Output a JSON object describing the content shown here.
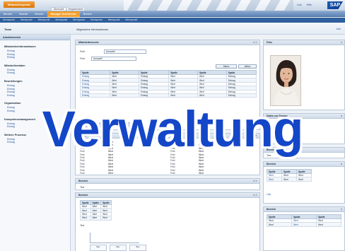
{
  "header": {
    "brand": "Mitarbeiterportal",
    "tab_active": "Übersicht",
    "tab_other": "Registerkarte",
    "links": [
      "Link",
      "Hilfe"
    ],
    "logo": "SAP"
  },
  "nav1": [
    "Bereich",
    "Bereich",
    "Bereich",
    "Manager Self-Service",
    "Bereich"
  ],
  "nav1_active_index": 3,
  "nav2": [
    "Menüpunkt",
    "Menüpunkt",
    "Menüpunkt",
    "Menüpunkt",
    "Menüpunkt",
    "Menüpunkt",
    "Menüpunkt",
    "Menüpunkt"
  ],
  "titlebar": {
    "left": "Team",
    "middle": "Allgemeine Informationen",
    "right": "Link"
  },
  "sidebar": {
    "header": "Arbeitsbereich",
    "groups": [
      {
        "title": "Mitarbeiterinformationen",
        "items": [
          "Eintrag",
          "Eintrag",
          "Eintrag"
        ]
      },
      {
        "title": "Mitarbeiterdaten",
        "items": [
          "Eintrag",
          "Eintrag"
        ]
      },
      {
        "title": "Beurteilungen",
        "items": [
          "Eintrag",
          "Eintrag",
          "Eintrag",
          "Eintrag"
        ]
      },
      {
        "title": "Organisation",
        "items": [
          "Eintrag",
          "Eintrag"
        ]
      },
      {
        "title": "Kompetenzmanagement",
        "items": [
          "Eintrag",
          "Eintrag"
        ]
      },
      {
        "title": "Weitere Prozesse",
        "items": [
          "Eintrag",
          "Eintrag"
        ]
      }
    ]
  },
  "panel_search": {
    "title": "Mitarbeitersuche",
    "field1_label": "Feld",
    "field1_value": "Auswahl",
    "field2_label": "Feld",
    "field2_value": "Auswahl",
    "btn1": "Aktion",
    "btn2": "Aktion",
    "columns": [
      "Spalte",
      "Spalte",
      "Spalte",
      "Spalte",
      "Spalte",
      "Spalte"
    ],
    "rows": [
      [
        "Eintrag",
        "Wert",
        "Eintrag",
        "Wert",
        "Wert",
        "Eintrag"
      ],
      [
        "Eintrag",
        "Wert",
        "Eintrag",
        "Wert",
        "Wert",
        "Eintrag"
      ],
      [
        "Eintrag",
        "Wert",
        "Eintrag",
        "Wert",
        "Wert",
        "Eintrag"
      ],
      [
        "Eintrag",
        "Wert",
        "Eintrag",
        "Wert",
        "Wert",
        "Eintrag"
      ],
      [
        "Eintrag",
        "Wert",
        "Eintrag",
        "Wert",
        "Wert",
        "Eintrag"
      ],
      [
        "Eintrag",
        "Wert",
        "Eintrag",
        "Wert",
        "Wert",
        "Eintrag"
      ]
    ],
    "selected_row": 1
  },
  "panel_details": {
    "title": "Details",
    "pairs_left": [
      [
        "Feld",
        "Wert"
      ],
      [
        "Feld",
        "Wert"
      ],
      [
        "Feld",
        "Wert"
      ],
      [
        "Feld",
        "Wert"
      ],
      [
        "Feld",
        "Wert"
      ],
      [
        "Feld",
        "Wert"
      ],
      [
        "Feld",
        "Wert"
      ],
      [
        "Feld",
        "Wert"
      ],
      [
        "Feld",
        "Wert"
      ],
      [
        "Feld",
        "Wert"
      ],
      [
        "Feld",
        "Wert"
      ]
    ],
    "pairs_right": [
      [
        "Feld",
        "Wert"
      ],
      [
        "Feld",
        "Wert"
      ],
      [
        "Feld",
        "Wert"
      ],
      [
        "Feld",
        "Wert"
      ],
      [
        "Feld",
        "Wert"
      ],
      [
        "Feld",
        "Wert"
      ],
      [
        "Feld",
        "Wert"
      ],
      [
        "Feld",
        "Wert"
      ],
      [
        "Feld",
        "Wert"
      ],
      [
        "Feld",
        "Wert"
      ],
      [
        "Feld",
        "Wert"
      ]
    ]
  },
  "panel_small": {
    "title": "Bereich",
    "text": "Text"
  },
  "panel_org": {
    "title": "Bereich",
    "columns": [
      "Spalte",
      "Spalte",
      "Spalte"
    ],
    "rows": [
      [
        "Wert",
        "Wert",
        "Wert"
      ],
      [
        "Wert",
        "Wert",
        "Wert"
      ],
      [
        "Wert",
        "Wert",
        "Wert"
      ],
      [
        "Wert",
        "Wert",
        "Wert"
      ]
    ],
    "footer": "Text",
    "chart_boxes": [
      "Box",
      "Box",
      "Box"
    ]
  },
  "right": {
    "photo_title": "Foto",
    "person_title": "Daten zur Person",
    "person_pairs": [
      [
        "Feld",
        "Wert"
      ],
      [
        "Feld",
        "Wert"
      ],
      [
        "Feld",
        "Wert"
      ],
      [
        "Feld",
        "Wert"
      ]
    ],
    "mini_title": "Bereich",
    "mini_text": "Text",
    "qual_title": "Bereich",
    "qual_columns": [
      "Spalte",
      "Spalte",
      "Spalte"
    ],
    "qual_rows": [
      [
        "Wert",
        "Wert",
        "Wert"
      ],
      [
        "Wert",
        "Wert",
        "Wert"
      ]
    ],
    "qual_link": "Link",
    "docs_title": "Bereich",
    "docs_columns": [
      "Spalte",
      "Spalte",
      "Spalte"
    ],
    "docs_rows": [
      [
        "Wert",
        "Wert",
        "Wert"
      ],
      [
        "Wert",
        "Wert",
        "Wert"
      ]
    ]
  },
  "watermark": "Verwaltung"
}
